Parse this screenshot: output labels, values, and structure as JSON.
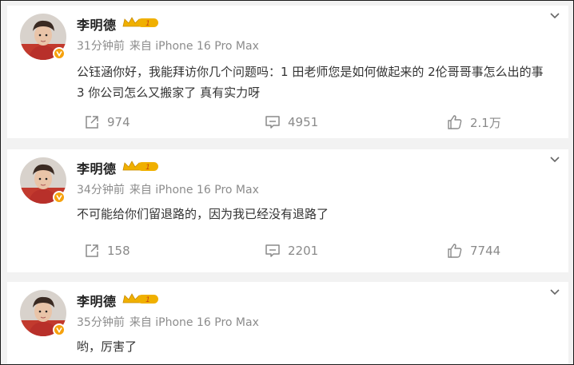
{
  "posts": [
    {
      "author": "李明德",
      "time": "31分钟前",
      "source": "来自 iPhone 16 Pro Max",
      "text": "公钰涵你好，我能拜访你几个问题吗：1 田老师您是如何做起来的 2伦哥哥事怎么出的事 3 你公司怎么又搬家了 真有实力呀",
      "shares": "974",
      "comments": "4951",
      "likes": "2.1万"
    },
    {
      "author": "李明德",
      "time": "34分钟前",
      "source": "来自 iPhone 16 Pro Max",
      "text": "不可能给你们留退路的，因为我已经没有退路了",
      "shares": "158",
      "comments": "2201",
      "likes": "7744"
    },
    {
      "author": "李明德",
      "time": "35分钟前",
      "source": "来自 iPhone 16 Pro Max",
      "text": "哟，厉害了"
    }
  ],
  "level_badge": "1",
  "icons": {
    "share": "share-icon",
    "comment": "comment-icon",
    "like": "thumbs-up-icon",
    "more": "chevron-down-icon",
    "verified": "verified-v-icon",
    "level": "crown-level-icon"
  },
  "colors": {
    "verified_badge": "#f6a10c",
    "crown": "#f0b000",
    "avatar_bg": "#c23a2e",
    "meta_text": "#8c8c8c",
    "action_text": "#8a8a8a"
  }
}
